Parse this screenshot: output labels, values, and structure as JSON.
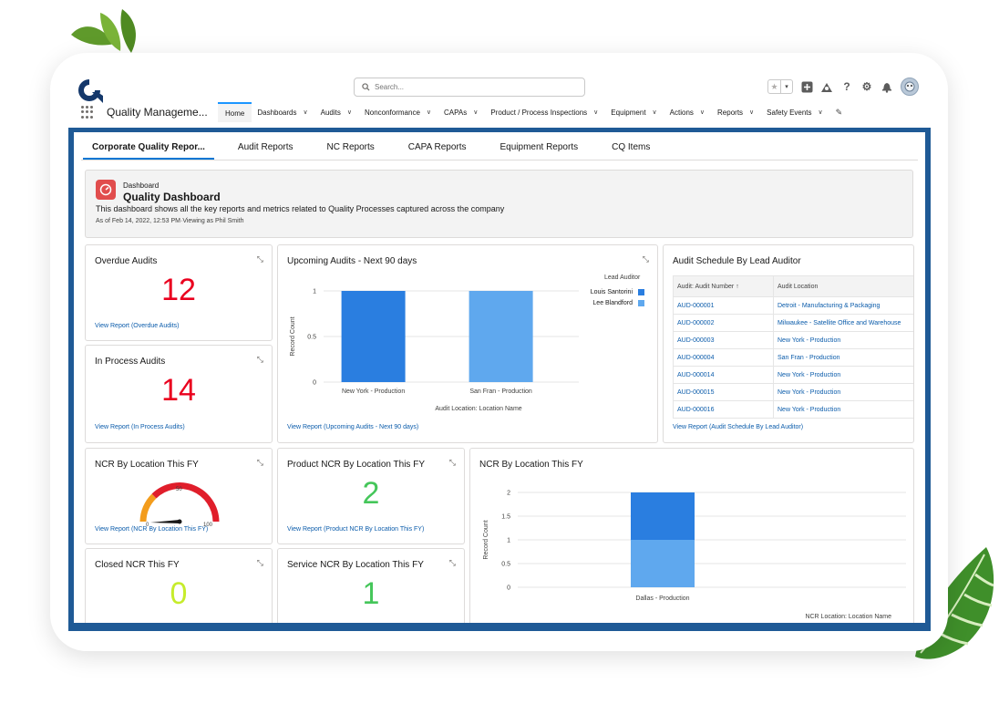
{
  "header": {
    "search_placeholder": "Search...",
    "app_name": "Quality Manageme..."
  },
  "nav": {
    "items": [
      {
        "label": "Home"
      },
      {
        "label": "Dashboards"
      },
      {
        "label": "Audits"
      },
      {
        "label": "Nonconformance"
      },
      {
        "label": "CAPAs"
      },
      {
        "label": "Product / Process Inspections"
      },
      {
        "label": "Equipment"
      },
      {
        "label": "Actions"
      },
      {
        "label": "Reports"
      },
      {
        "label": "Safety Events"
      }
    ]
  },
  "tabs": [
    {
      "label": "Corporate Quality Repor..."
    },
    {
      "label": "Audit Reports"
    },
    {
      "label": "NC Reports"
    },
    {
      "label": "CAPA Reports"
    },
    {
      "label": "Equipment Reports"
    },
    {
      "label": "CQ Items"
    }
  ],
  "dashboard": {
    "kicker": "Dashboard",
    "title": "Quality Dashboard",
    "description": "This dashboard shows all the key reports and metrics related to Quality Processes captured across the company",
    "meta": "As of Feb 14, 2022, 12:53 PM·Viewing as Phil Smith"
  },
  "widgets": {
    "overdue": {
      "title": "Overdue Audits",
      "value": "12",
      "link": "View Report (Overdue Audits)"
    },
    "in_process": {
      "title": "In Process Audits",
      "value": "14",
      "link": "View Report (In Process Audits)"
    },
    "upcoming": {
      "title": "Upcoming Audits - Next 90 days",
      "link": "View Report (Upcoming Audits - Next 90 days)"
    },
    "schedule": {
      "title": "Audit Schedule By Lead Auditor",
      "link": "View Report (Audit Schedule By Lead Auditor)",
      "col1": "Audit: Audit Number",
      "sort_arrow": "↑",
      "col2": "Audit Location",
      "rows": [
        {
          "num": "AUD-000001",
          "loc": "Detroit - Manufacturing & Packaging"
        },
        {
          "num": "AUD-000002",
          "loc": "Milwaukee - Satellite Office and Warehouse"
        },
        {
          "num": "AUD-000003",
          "loc": "New York - Production"
        },
        {
          "num": "AUD-000004",
          "loc": "San Fran - Production"
        },
        {
          "num": "AUD-000014",
          "loc": "New York - Production"
        },
        {
          "num": "AUD-000015",
          "loc": "New York - Production"
        },
        {
          "num": "AUD-000016",
          "loc": "New York - Production"
        }
      ]
    },
    "ncr_gauge": {
      "title": "NCR By Location This FY",
      "link": "View Report (NCR By Location This FY)",
      "min": "0",
      "mid": "50",
      "max": "100",
      "value": 0
    },
    "product_ncr": {
      "title": "Product NCR By Location This FY",
      "value": "2",
      "link": "View Report (Product NCR By Location This FY)"
    },
    "closed_ncr": {
      "title": "Closed NCR This FY",
      "value": "0"
    },
    "service_ncr": {
      "title": "Service NCR By Location This FY",
      "value": "1"
    },
    "ncr_chart": {
      "title": "NCR By Location This FY"
    }
  },
  "colors": {
    "dark_blue": "#2a7ee0",
    "light_blue": "#5fa8ee",
    "brand": "#1f5a96"
  },
  "chart_data": [
    {
      "type": "bar",
      "title": "Upcoming Audits - Next 90 days",
      "xlabel": "Audit Location: Location Name",
      "ylabel": "Record Count",
      "legend_title": "Lead Auditor",
      "legend_position": "top-right",
      "ylim": [
        0,
        1
      ],
      "yticks": [
        "0",
        "0.5",
        "1"
      ],
      "categories": [
        "New York - Production",
        "San Fran - Production"
      ],
      "series": [
        {
          "name": "Louis Santorini",
          "values": [
            1,
            0
          ],
          "color": "#2a7ee0"
        },
        {
          "name": "Lee Blandford",
          "values": [
            0,
            1
          ],
          "color": "#5fa8ee"
        }
      ]
    },
    {
      "type": "bar",
      "title": "NCR By Location This FY",
      "xlabel": "NCR Location: Location Name",
      "ylabel": "Record Count",
      "stacked": true,
      "ylim": [
        0,
        2
      ],
      "yticks": [
        "0",
        "0.5",
        "1",
        "1.5",
        "2"
      ],
      "categories": [
        "Dallas - Production"
      ],
      "series": [
        {
          "values": [
            1
          ],
          "color": "#5fa8ee"
        },
        {
          "values": [
            1
          ],
          "color": "#2a7ee0"
        }
      ]
    }
  ]
}
